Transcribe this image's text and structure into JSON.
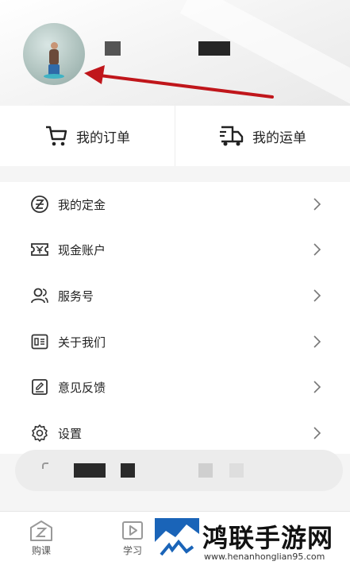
{
  "orders": {
    "my_orders_label": "我的订单",
    "my_shipments_label": "我的运单"
  },
  "menu": {
    "items": [
      {
        "label": "我的定金",
        "icon": "deposit-icon"
      },
      {
        "label": "现金账户",
        "icon": "cash-account-icon"
      },
      {
        "label": "服务号",
        "icon": "service-icon"
      },
      {
        "label": "关于我们",
        "icon": "about-icon"
      },
      {
        "label": "意见反馈",
        "icon": "feedback-icon"
      },
      {
        "label": "设置",
        "icon": "settings-icon"
      }
    ]
  },
  "bottom_nav": {
    "items": [
      {
        "label": "购课",
        "icon": "course-icon"
      },
      {
        "label": "学习",
        "icon": "play-icon"
      }
    ]
  },
  "watermark": {
    "title": "鸿联手游网",
    "url": "www.henanhonglian95.com"
  },
  "colors": {
    "arrow": "#c0161b",
    "accent_text": "#222222"
  }
}
